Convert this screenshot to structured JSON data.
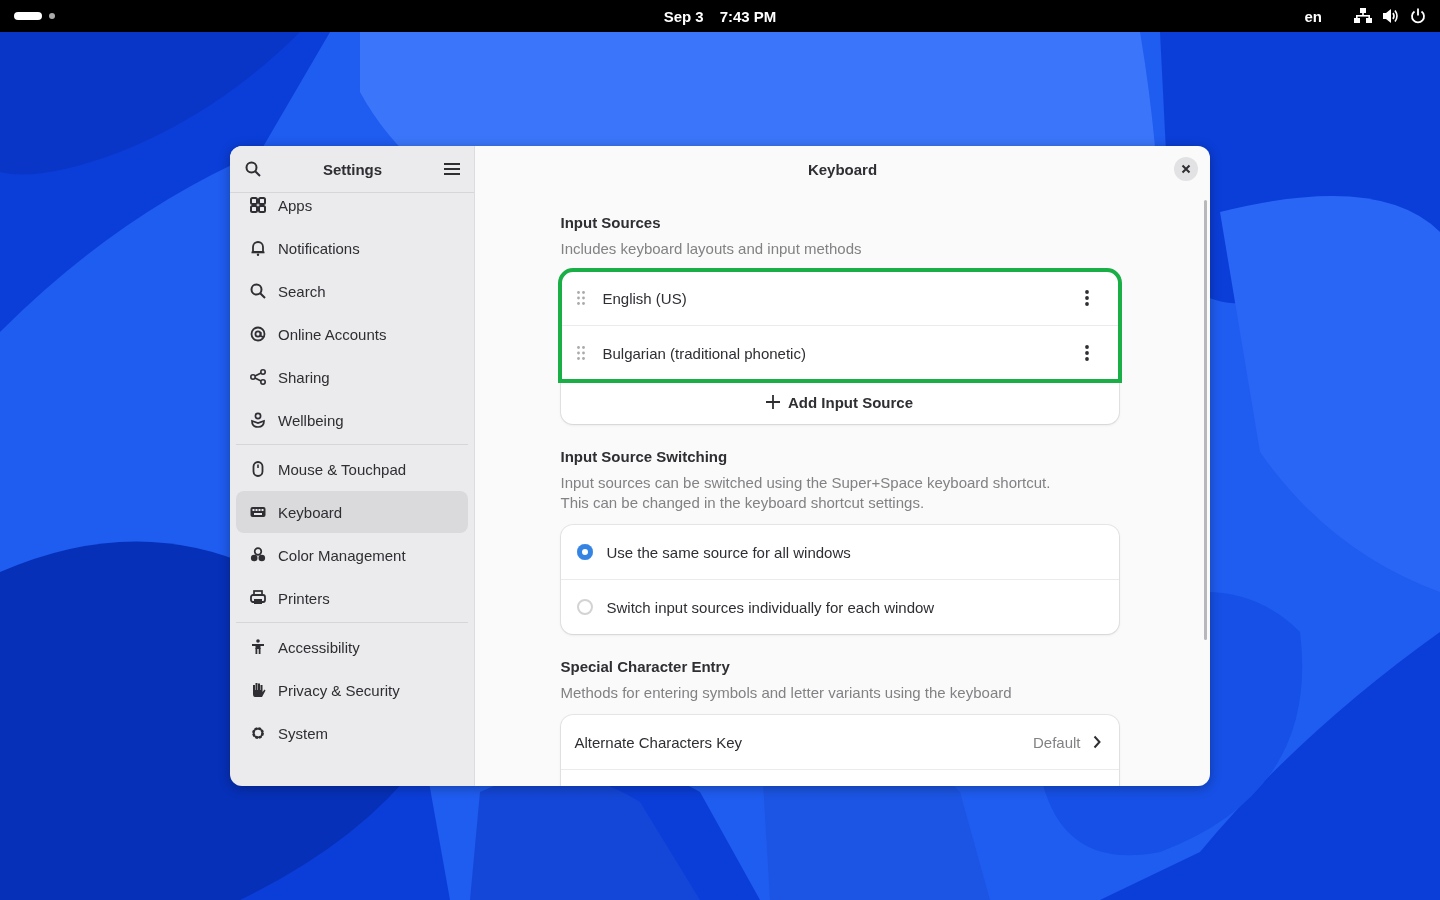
{
  "top_bar": {
    "date": "Sep 3",
    "time": "7:43 PM",
    "keyboard_layout": "en"
  },
  "window": {
    "sidebar_title": "Settings",
    "title": "Keyboard"
  },
  "sidebar": {
    "groups": [
      {
        "items": [
          {
            "label": "Apps",
            "selected": false
          },
          {
            "label": "Notifications",
            "selected": false
          },
          {
            "label": "Search",
            "selected": false
          },
          {
            "label": "Online Accounts",
            "selected": false
          },
          {
            "label": "Sharing",
            "selected": false
          },
          {
            "label": "Wellbeing",
            "selected": false
          }
        ]
      },
      {
        "items": [
          {
            "label": "Mouse & Touchpad",
            "selected": false
          },
          {
            "label": "Keyboard",
            "selected": true
          },
          {
            "label": "Color Management",
            "selected": false
          },
          {
            "label": "Printers",
            "selected": false
          }
        ]
      },
      {
        "items": [
          {
            "label": "Accessibility",
            "selected": false
          },
          {
            "label": "Privacy & Security",
            "selected": false
          },
          {
            "label": "System",
            "selected": false
          }
        ]
      }
    ]
  },
  "input_sources": {
    "title": "Input Sources",
    "description": "Includes keyboard layouts and input methods",
    "highlighted": true,
    "sources": [
      {
        "name": "English (US)"
      },
      {
        "name": "Bulgarian (traditional phonetic)"
      }
    ],
    "add_button": "Add Input Source"
  },
  "switching": {
    "title": "Input Source Switching",
    "description": [
      "Input sources can be switched using the Super+Space keyboard shortcut.",
      "This can be changed in the keyboard shortcut settings."
    ],
    "options": [
      {
        "label": "Use the same source for all windows",
        "selected": true
      },
      {
        "label": "Switch input sources individually for each window",
        "selected": false
      }
    ]
  },
  "special_chars": {
    "title": "Special Character Entry",
    "description": "Methods for entering symbols and letter variants using the keyboard",
    "rows": [
      {
        "label": "Alternate Characters Key",
        "value": "Default"
      }
    ]
  }
}
